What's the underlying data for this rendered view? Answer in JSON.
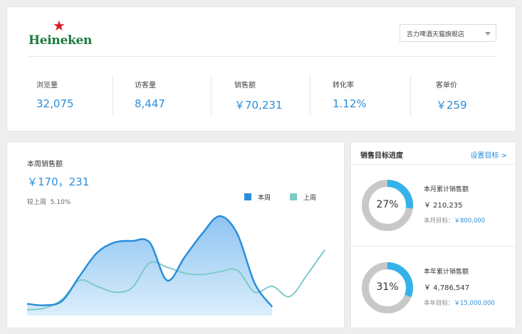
{
  "brand": {
    "name": "Heineken",
    "star": "★",
    "star_color": "#d71f26",
    "text_color": "#1a7a3c"
  },
  "store_select": {
    "value": "吉力啤酒天猫旗舰店"
  },
  "metrics": [
    {
      "label": "浏览量",
      "value": "32,075"
    },
    {
      "label": "访客量",
      "value": "8,447"
    },
    {
      "label": "销售额",
      "value": "￥70,231"
    },
    {
      "label": "转化率",
      "value": "1.12%"
    },
    {
      "label": "客单价",
      "value": "￥259"
    }
  ],
  "sales": {
    "title": "本周销售额",
    "total": "￥170，231",
    "compare_label": "较上周",
    "compare_value": "5.10%"
  },
  "chart_data": {
    "type": "area",
    "series": [
      {
        "name": "本周",
        "color": "#2b8ed9",
        "fill": "area",
        "values": [
          8,
          7,
          10,
          27,
          43,
          50,
          51,
          50,
          24,
          40,
          56,
          68,
          56,
          22,
          6
        ]
      },
      {
        "name": "上周",
        "color": "#7ecbc7",
        "fill": "none",
        "values": [
          4,
          5,
          11,
          24,
          20,
          16,
          19,
          36,
          33,
          29,
          28,
          30,
          31,
          16,
          20,
          13,
          28,
          45
        ]
      }
    ]
  },
  "targets": {
    "title": "销售目标进度",
    "link": "设置目标 >",
    "items": [
      {
        "percent": 27,
        "percent_label": "27%",
        "label": "本月累计销售额",
        "amount": "￥ 210,235",
        "goal_label": "本月目标：",
        "goal_value": "￥800,000"
      },
      {
        "percent": 31,
        "percent_label": "31%",
        "label": "本年累计销售额",
        "amount": "￥ 4,786,547",
        "goal_label": "本年目标：",
        "goal_value": "￥15,000,000"
      }
    ]
  },
  "colors": {
    "accent": "#2b8ed9",
    "teal": "#7ecbc7",
    "ring_track": "#c8c8c8",
    "ring_fill": "#35b3e8"
  }
}
